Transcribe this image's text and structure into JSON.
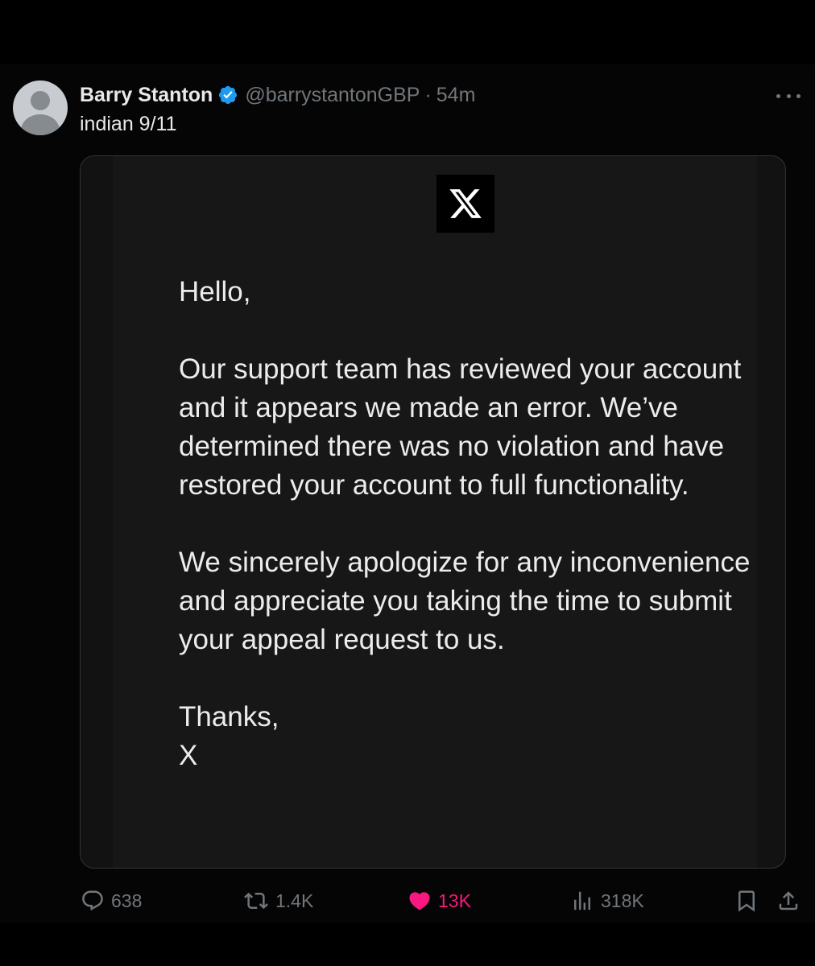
{
  "tweet": {
    "display_name": "Barry Stanton",
    "handle": "@barrystantonGBP",
    "separator": "·",
    "time": "54m",
    "text": "indian 9/11"
  },
  "card": {
    "greeting": "Hello,",
    "paragraph1": "Our support team has reviewed your account and it appears we made an error. We’ve determined there was no violation and have restored your account to full functionality.",
    "paragraph2": "We sincerely apologize for any inconvenience and appreciate you taking the time to submit your appeal request to us.",
    "signoff": "Thanks,",
    "signature": "X"
  },
  "stats": {
    "replies": "638",
    "reposts": "1.4K",
    "likes": "13K",
    "views": "318K"
  },
  "colors": {
    "like_active": "#f91880",
    "verified": "#1d9bf0",
    "muted": "#71767b"
  },
  "icons": [
    "verified-badge-icon",
    "more-options-icon",
    "x-logo-icon",
    "reply-icon",
    "repost-icon",
    "like-icon",
    "views-icon",
    "bookmark-icon",
    "share-icon"
  ]
}
